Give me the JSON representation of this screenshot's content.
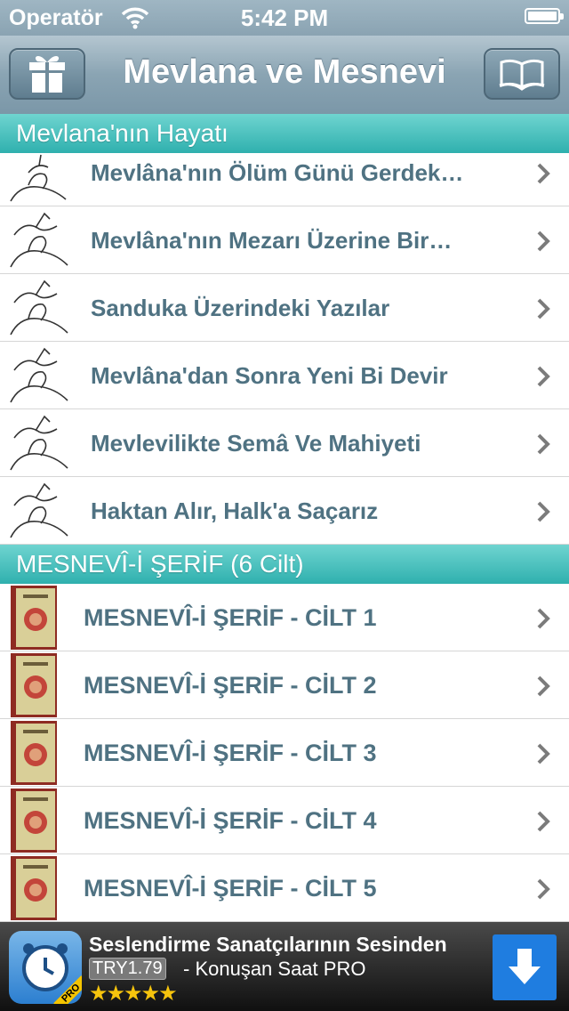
{
  "status": {
    "carrier": "Operatör",
    "time": "5:42 PM"
  },
  "nav": {
    "title": "Mevlana ve Mesnevi",
    "left_icon": "gift-icon",
    "right_icon": "book-icon"
  },
  "sections": [
    {
      "title": "Mevlana'nın Hayatı",
      "items": [
        {
          "label": "Mevlâna'nın Ölüm Günü Gerdek…"
        },
        {
          "label": "Mevlâna'nın Mezarı Üzerine Bir…"
        },
        {
          "label": "Sanduka Üzerindeki Yazılar"
        },
        {
          "label": "Mevlâna'dan Sonra Yeni Bi Devir"
        },
        {
          "label": "Mevlevilikte Semâ Ve Mahiyeti"
        },
        {
          "label": "Haktan Alır, Halk'a Saçarız"
        }
      ]
    },
    {
      "title": "MESNEVÎ-İ ŞERİF (6 Cilt)",
      "items": [
        {
          "label": "MESNEVÎ-İ ŞERİF - CİLT 1"
        },
        {
          "label": "MESNEVÎ-İ ŞERİF - CİLT 2"
        },
        {
          "label": "MESNEVÎ-İ ŞERİF - CİLT 3"
        },
        {
          "label": "MESNEVÎ-İ ŞERİF - CİLT 4"
        },
        {
          "label": "MESNEVÎ-İ ŞERİF - CİLT 5"
        }
      ]
    }
  ],
  "ad": {
    "headline": "Seslendirme Sanatçılarının Sesinden",
    "price": "TRY1.79",
    "app_name": "- Konuşan Saat PRO",
    "stars": "★★★★★",
    "badge": "PRO",
    "rating": 5
  },
  "colors": {
    "accent": "#2fb0ae",
    "row_text": "#4f7282",
    "nav": "#8aa4b3"
  }
}
